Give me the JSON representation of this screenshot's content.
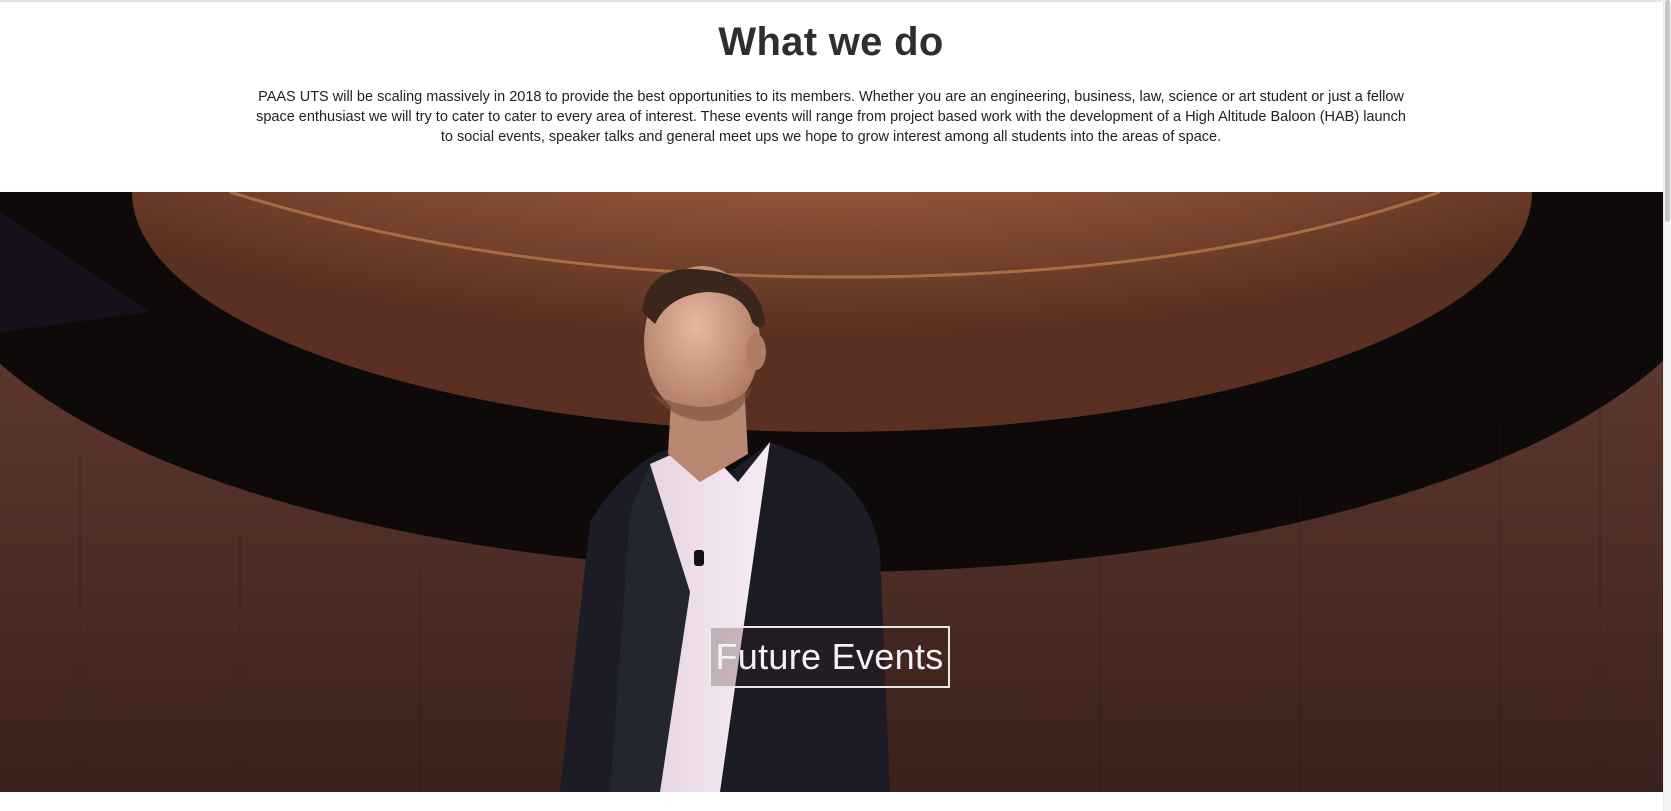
{
  "what_we_do": {
    "title": "What we do",
    "text": "PAAS UTS will be scaling massively in 2018 to provide the best opportunities to its members. Whether you are an engineering, business, law, science or art student or just a fellow space enthusiast we will try to cater to cater to every area of interest. These events will range from project based work with the development of a High Altitude Baloon (HAB) launch to social events, speaker talks and general meet ups we hope to grow interest among all students into the areas of space."
  },
  "hero": {
    "button_label": "Future Events"
  },
  "colors": {
    "title": "#2e2e2e",
    "body_text": "#222222",
    "hero_dark": "#3a1e18",
    "dome_copper": "#b06a48",
    "button_border": "#e8e8e8"
  }
}
